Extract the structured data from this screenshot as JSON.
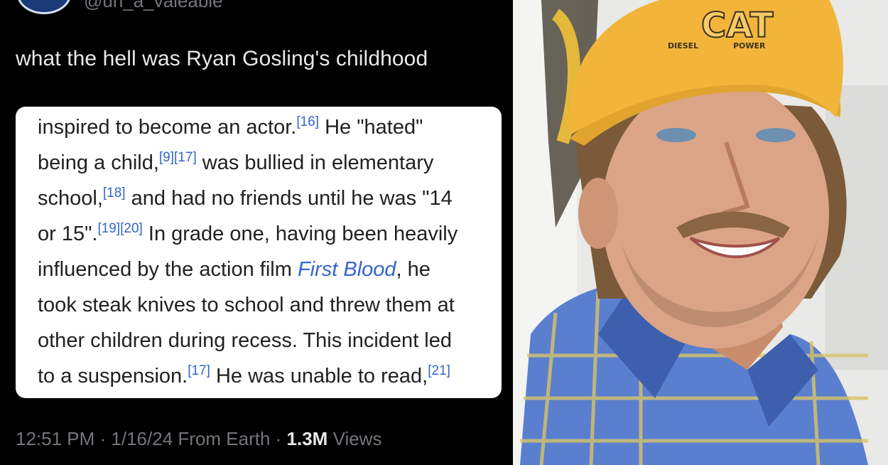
{
  "tweet": {
    "handle": "@un_a_valeable",
    "text": "what the hell was Ryan Gosling's childhood",
    "meta": {
      "time": "12:51 PM",
      "date": "1/16/24",
      "source": "From Earth",
      "views_count": "1.3M",
      "views_label": "Views"
    }
  },
  "wiki": {
    "lines": [
      [
        "inspired to become an actor.",
        "[16]",
        " He \"hated\""
      ],
      [
        "being a child,",
        "[9][17]",
        " was bullied in elementary"
      ],
      [
        "school,",
        "[18]",
        " and had no friends until he was \"14"
      ],
      [
        "or 15\".",
        "[19][20]",
        " In grade one, having been heavily"
      ],
      [
        "influenced by the action film ",
        "First Blood",
        ", he"
      ],
      [
        "took steak knives to school and threw them at"
      ],
      [
        "other children during recess. This incident led"
      ],
      [
        "to a suspension.",
        "[17]",
        " He was unable to read,",
        "[21]"
      ]
    ]
  },
  "photo": {
    "cap_brand": "CAT",
    "cap_sub_left": "DIESEL",
    "cap_sub_right": "POWER",
    "cap_color": "#f2b53a",
    "shirt_color": "#5b7fcf",
    "background_color": "#e9e9e7"
  }
}
